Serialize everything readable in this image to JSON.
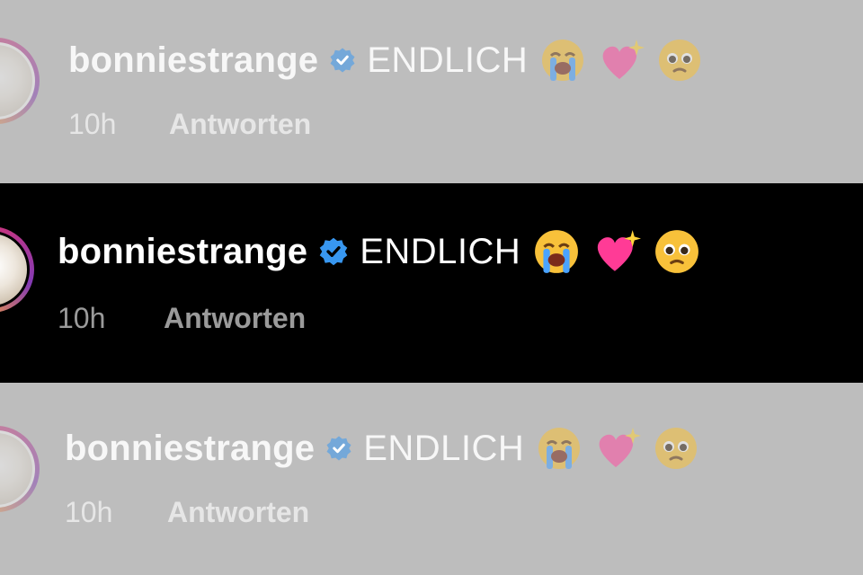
{
  "comments": [
    {
      "username": "bonniestrange",
      "text": "ENDLICH",
      "time": "10h",
      "reply_label": "Antworten",
      "emojis": [
        "loudly-crying-face",
        "sparkling-heart",
        "pleading-face"
      ]
    },
    {
      "username": "bonniestrange",
      "text": "ENDLICH",
      "time": "10h",
      "reply_label": "Antworten",
      "emojis": [
        "loudly-crying-face",
        "sparkling-heart",
        "pleading-face"
      ]
    },
    {
      "username": "bonniestrange",
      "text": "ENDLICH",
      "time": "10h",
      "reply_label": "Antworten",
      "emojis": [
        "loudly-crying-face",
        "sparkling-heart",
        "pleading-face"
      ]
    }
  ],
  "colors": {
    "verified_badge": "#3897f0",
    "focus_background": "#000000",
    "faded_background": "#bdbdbd",
    "avatar_ring": [
      "#f9a13b",
      "#e1306c",
      "#c13584",
      "#833ab4"
    ]
  }
}
